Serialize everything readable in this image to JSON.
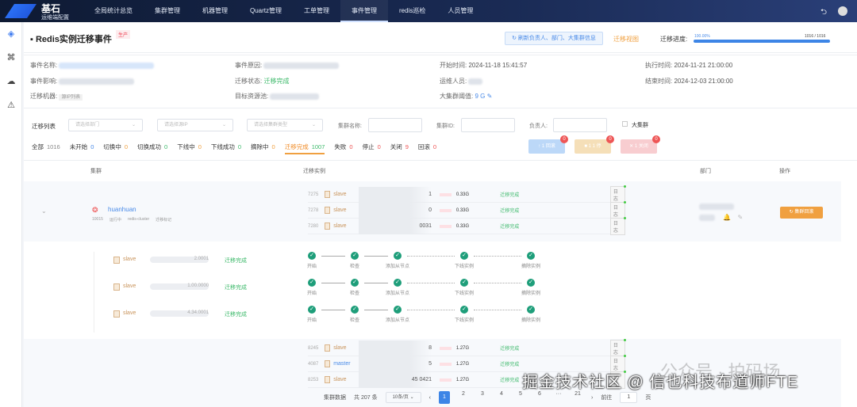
{
  "app": {
    "logo_title": "基石",
    "logo_subtitle": "运维端配置"
  },
  "nav": [
    "全局统计总览",
    "集群管理",
    "机器管理",
    "Quartz管理",
    "工单管理",
    "事件管理",
    "redis巡检",
    "人员管理"
  ],
  "nav_active": 5,
  "page": {
    "title": "Redis实例迁移事件",
    "env_tag": "生产",
    "refresh_button": "刷新负责人、部门、大集群信息",
    "view_link": "迁移视图",
    "progress_label": "迁移进度:",
    "progress_percent_text": "100.00%",
    "progress_fraction": 1.0,
    "progress_count": "1016 / 1016"
  },
  "info": {
    "event_name_label": "事件名称:",
    "event_reason_label": "事件原因:",
    "start_time_label": "开始时间:",
    "start_time": "2024-11-18 15:41:57",
    "exec_time_label": "执行时间:",
    "exec_time": "2024-11-21 21:00:00",
    "impact_label": "事件影响:",
    "status_label": "迁移状态:",
    "status": "迁移完成",
    "operator_label": "运维人员:",
    "end_time_label": "结束时间:",
    "end_time": "2024-12-03 21:00:00",
    "machine_label": "迁移机器:",
    "machine_value": "源IP列表",
    "pool_label": "目标资源池:",
    "threshold_label": "大集群阈值:",
    "threshold": "9 G"
  },
  "filters": {
    "list_label": "迁移列表",
    "dept_placeholder": "请选择部门",
    "ip_placeholder": "请选择源IP",
    "type_placeholder": "请选择集群类型",
    "cluster_name_label": "集群名称:",
    "cluster_id_label": "集群ID:",
    "owner_label": "负责人:",
    "big_cluster_label": "大集群"
  },
  "status_tabs": [
    {
      "label": "全部",
      "count": "1016",
      "color": "#888"
    },
    {
      "label": "未开始",
      "count": "0",
      "color": "#4a8be8"
    },
    {
      "label": "切换中",
      "count": "0",
      "color": "#f0a040"
    },
    {
      "label": "切换成功",
      "count": "0",
      "color": "#3cb96a"
    },
    {
      "label": "下线中",
      "count": "0",
      "color": "#f0a040"
    },
    {
      "label": "下线成功",
      "count": "0",
      "color": "#3cb96a"
    },
    {
      "label": "摘除中",
      "count": "0",
      "color": "#f0a040"
    },
    {
      "label": "迁移完成",
      "count": "1007",
      "color": "#3cb96a"
    },
    {
      "label": "失败",
      "count": "0",
      "color": "#e55"
    },
    {
      "label": "停止",
      "count": "0",
      "color": "#e55"
    },
    {
      "label": "关闭",
      "count": "9",
      "color": "#e55"
    },
    {
      "label": "回滚",
      "count": "0",
      "color": "#e55"
    }
  ],
  "action_buttons": [
    {
      "label": "↑ 1 回滚",
      "badge": "0",
      "color": "#bcd8f8"
    },
    {
      "label": "■ 1 1 停",
      "badge": "0",
      "color": "#f5dfb8"
    },
    {
      "label": "✕ 1 关闭",
      "badge": "0",
      "color": "#f8cdd0"
    }
  ],
  "table": {
    "headers": {
      "cluster": "集群",
      "instances": "迁移实例",
      "dept": "部门",
      "ops": "操作"
    },
    "cluster1": {
      "name": "huanhuan",
      "id": "10015",
      "state": "运行中",
      "type": "redis-cluster",
      "extra": "迁移标记",
      "action": "集群回滚",
      "instances": [
        {
          "id": "7275",
          "role": "slave",
          "suffix": "1",
          "size": "0.33G",
          "status": "迁移完成",
          "log": "日志"
        },
        {
          "id": "7278",
          "role": "slave",
          "suffix": "0",
          "size": "0.33G",
          "status": "迁移完成",
          "log": "日志"
        },
        {
          "id": "7280",
          "role": "slave",
          "suffix": "0031",
          "size": "0.33G",
          "status": "迁移完成",
          "log": "日志"
        }
      ]
    },
    "detail_rows": [
      {
        "role": "slave",
        "ip": "2.0001",
        "status": "迁移完成"
      },
      {
        "role": "slave",
        "ip": "1.00.0000",
        "status": "迁移完成"
      },
      {
        "role": "slave",
        "ip": "4.34.0001",
        "status": "迁移完成"
      }
    ],
    "steps": [
      "开始",
      "检查",
      "添加从节点",
      "下线实例",
      "摘除实例"
    ],
    "cluster2": {
      "instances": [
        {
          "id": "8245",
          "role": "slave",
          "suffix": "8",
          "size": "1.27G",
          "status": "迁移完成",
          "log": "日志"
        },
        {
          "id": "4087",
          "role": "master",
          "suffix": "5",
          "size": "1.27G",
          "status": "迁移完成",
          "log": "日志"
        },
        {
          "id": "8253",
          "role": "slave",
          "suffix": "45 0421",
          "size": "1.27G",
          "status": "迁移完成",
          "log": "日志"
        }
      ]
    }
  },
  "pagination": {
    "label": "集群数据",
    "total": "共 207 条",
    "page_size": "10条/页",
    "pages": [
      "1",
      "2",
      "3",
      "4",
      "5",
      "6",
      "···",
      "21"
    ],
    "current": "1",
    "goto_label": "前往",
    "goto_value": "1",
    "page_suffix": "页"
  },
  "watermark": {
    "text": "掘金技术社区 @ 信也科技布道师FTE",
    "text2": "公众号 · 拍码场"
  }
}
